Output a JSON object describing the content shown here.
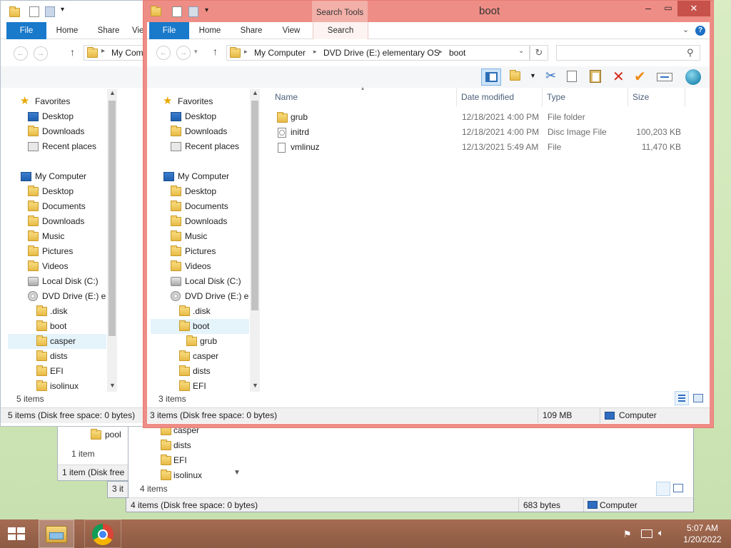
{
  "colors": {
    "accent": "#1979ca",
    "active_border": "#ec8a80",
    "taskbar": "#9a6249"
  },
  "back_window_2": {
    "title": "",
    "breadcrumb_visible": "My Com",
    "status_count": "5 items",
    "status_bar": "5 items (Disk free space: 0 bytes)"
  },
  "back_window_3": {
    "nav_items": [
      "pool"
    ],
    "status_count": "1 item",
    "status_bar": "1 item (Disk free",
    "tail": "3 it"
  },
  "back_window_1": {
    "nav_items": [
      "casper",
      "dists",
      "EFI",
      "isolinux"
    ],
    "status_count": "4 items",
    "status_bar": "4 items (Disk free space: 0 bytes)",
    "status_size": "683 bytes",
    "status_location": "Computer"
  },
  "ribbon_tabs": [
    "File",
    "Home",
    "Share",
    "View",
    "Search"
  ],
  "nav_common": {
    "favorites": "Favorites",
    "desktop": "Desktop",
    "downloads": "Downloads",
    "recent": "Recent places",
    "my_computer": "My Computer",
    "documents": "Documents",
    "music": "Music",
    "pictures": "Pictures",
    "videos": "Videos",
    "local_disk": "Local Disk (C:)",
    "dvd": "DVD Drive (E:) ele",
    "disk_folder": ".disk",
    "boot": "boot",
    "grub": "grub",
    "casper": "casper",
    "dists": "dists",
    "efi": "EFI",
    "isolinux": "isolinux"
  },
  "active_window": {
    "title": "boot",
    "contextual_tab_group": "Search Tools",
    "breadcrumb": [
      "My Computer",
      "DVD Drive (E:) elementary OS",
      "boot"
    ],
    "search_placeholder": "",
    "columns": [
      "Name",
      "Date modified",
      "Type",
      "Size"
    ],
    "files": [
      {
        "name": "grub",
        "date": "12/18/2021 4:00 PM",
        "type": "File folder",
        "size": "",
        "icon": "folder-icon"
      },
      {
        "name": "initrd",
        "date": "12/18/2021 4:00 PM",
        "type": "Disc Image File",
        "size": "100,203 KB",
        "icon": "disc-image-icon"
      },
      {
        "name": "vmlinuz",
        "date": "12/13/2021 5:49 AM",
        "type": "File",
        "size": "11,470 KB",
        "icon": "file-icon"
      }
    ],
    "status_count": "3 items",
    "status_bar": "3 items (Disk free space: 0 bytes)",
    "status_size": "109 MB",
    "status_location": "Computer"
  },
  "taskbar": {
    "time": "5:07 AM",
    "date": "1/20/2022"
  }
}
